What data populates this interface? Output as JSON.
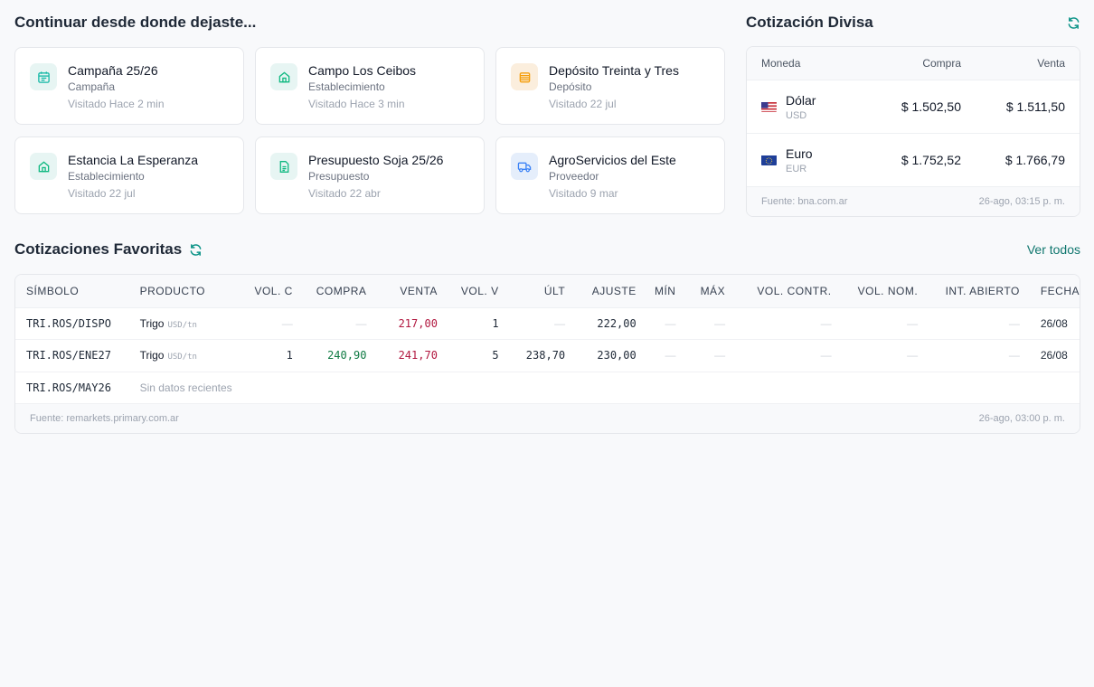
{
  "recent": {
    "title": "Continuar desde donde dejaste...",
    "items": [
      {
        "title": "Campaña 25/26",
        "type": "Campaña",
        "visited": "Visitado Hace 2 min",
        "icon": "calendar-icon",
        "color": "#14b8a6"
      },
      {
        "title": "Campo Los Ceibos",
        "type": "Establecimiento",
        "visited": "Visitado Hace 3 min",
        "icon": "home-icon",
        "color": "#10b981"
      },
      {
        "title": "Depósito Treinta y Tres",
        "type": "Depósito",
        "visited": "Visitado 22 jul",
        "icon": "warehouse-icon",
        "color": "#f59e0b"
      },
      {
        "title": "Estancia La Esperanza",
        "type": "Establecimiento",
        "visited": "Visitado 22 jul",
        "icon": "home-icon",
        "color": "#10b981"
      },
      {
        "title": "Presupuesto Soja 25/26",
        "type": "Presupuesto",
        "visited": "Visitado 22 abr",
        "icon": "document-icon",
        "color": "#10b981"
      },
      {
        "title": "AgroServicios del Este",
        "type": "Proveedor",
        "visited": "Visitado 9 mar",
        "icon": "truck-icon",
        "color": "#3b82f6"
      }
    ]
  },
  "fx": {
    "title": "Cotización Divisa",
    "columns": {
      "currency": "Moneda",
      "buy": "Compra",
      "sell": "Venta"
    },
    "rows": [
      {
        "name": "Dólar",
        "code": "USD",
        "buy": "$ 1.502,50",
        "sell": "$ 1.511,50",
        "flag": "us-flag-icon"
      },
      {
        "name": "Euro",
        "code": "EUR",
        "buy": "$ 1.752,52",
        "sell": "$ 1.766,79",
        "flag": "eu-flag-icon"
      }
    ],
    "source": "Fuente: bna.com.ar",
    "timestamp": "26-ago, 03:15 p. m."
  },
  "favorites": {
    "title": "Cotizaciones Favoritas",
    "see_all": "Ver todos",
    "columns": [
      "SÍMBOLO",
      "PRODUCTO",
      "VOL. C",
      "COMPRA",
      "VENTA",
      "VOL. V",
      "ÚLT",
      "AJUSTE",
      "MÍN",
      "MÁX",
      "VOL. CONTR.",
      "VOL. NOM.",
      "INT. ABIERTO",
      "FECHA"
    ],
    "rows": [
      {
        "symbol": "TRI.ROS/DISPO",
        "product": "Trigo",
        "unit": "USD/tn",
        "vol_c": "—",
        "compra": "—",
        "venta": "217,00",
        "vol_v": "1",
        "ult": "—",
        "ajuste": "222,00",
        "min": "—",
        "max": "—",
        "vol_contr": "—",
        "vol_nom": "—",
        "int_abierto": "—",
        "fecha": "26/08"
      },
      {
        "symbol": "TRI.ROS/ENE27",
        "product": "Trigo",
        "unit": "USD/tn",
        "vol_c": "1",
        "compra": "240,90",
        "venta": "241,70",
        "vol_v": "5",
        "ult": "238,70",
        "ajuste": "230,00",
        "min": "—",
        "max": "—",
        "vol_contr": "—",
        "vol_nom": "—",
        "int_abierto": "—",
        "fecha": "26/08"
      },
      {
        "symbol": "TRI.ROS/MAY26",
        "no_data": "Sin datos recientes"
      }
    ],
    "source": "Fuente: remarkets.primary.com.ar",
    "timestamp": "26-ago, 03:00 p. m."
  },
  "colors": {
    "accent": "#0f766e",
    "buy_green": "#0f7a43",
    "sell_red": "#b1173f"
  }
}
